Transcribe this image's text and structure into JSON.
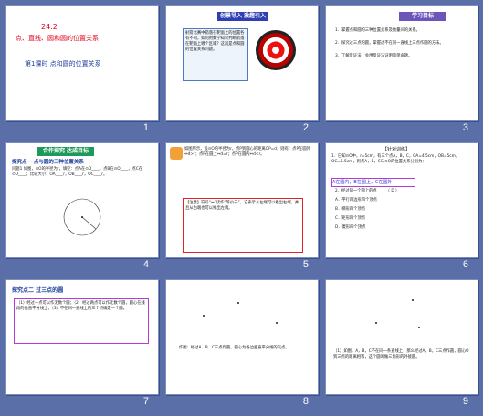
{
  "slides": [
    {
      "num": "1",
      "chapter": "24.2",
      "title": "点、直线、圆和圆的位置关系",
      "subtitle": "第1课时 点和圆的位置关系"
    },
    {
      "num": "2",
      "banner": "创景导入 激趣引入",
      "text": "射箭比赛中箭落在靶面上的位置各有不同，如何用数学知识判断箭落在靶面上哪个区域？这就是点和圆的位置关系问题。"
    },
    {
      "num": "3",
      "banner": "学习目标",
      "items": [
        "1．掌握点和圆的三种位置关系及数量间的关系。",
        "2．探究过三点的圆，掌握过不在同一直线上三点作圆的方法。",
        "3．了解反证法，会用反证法证明简单命题。"
      ]
    },
    {
      "num": "4",
      "banner": "合作探究 达成目标",
      "heading": "探究点一 点与圆的三种位置关系",
      "text": "问题1 如图，⊙O的半径为r，填空：点A在⊙O____，点B在⊙O____，点C在⊙O____；比较大小：OA____r，OB____r，OC____r。"
    },
    {
      "num": "5",
      "text": "如图所示，设⊙O的半径为r，点P到圆心的距离OP=d，则有：点P在圆外⇔d>r；点P在圆上⇔d=r；点P在圆内⇔d<r。",
      "note": "【注意】符号“⇔”读作“等价于”，它表示从左端可以推出右端，并且从右端也可以推出左端。"
    },
    {
      "num": "6",
      "label": "【针对训练】",
      "question": "1．已知⊙O中，r=5cm，有三个点A，B，C，OA=4.5cm，OB=5cm，OC=5.5cm，则点A，B，C与⊙O的位置关系分别为：",
      "answer": "A在圆内，B在圆上，C在圆外",
      "q2": "2．经过同一个圆上的点 ____（ D ）",
      "options": [
        "A．平行四边形四个顶点",
        "B．梯形四个顶点",
        "C．矩形四个顶点",
        "D．菱形四个顶点"
      ],
      "choice": "D"
    },
    {
      "num": "7",
      "heading": "探究点二 过三点的圆",
      "text": "（1）经过一点可以作无数个圆；（2）经过两点可以作无数个圆，圆心在线段的垂直平分线上；（3）不在同一直线上的三个点确定一个圆。"
    },
    {
      "num": "8",
      "caption": "作图：经过A、B、C三点作圆，圆心为各边垂直平分线的交点。"
    },
    {
      "num": "9",
      "text": "（1）如图，A，B，C不在同一条直线上，那么经过A，B，C三点作圆，圆心O到三点的距离相等，这个圆叫做三角形的外接圆。"
    }
  ]
}
